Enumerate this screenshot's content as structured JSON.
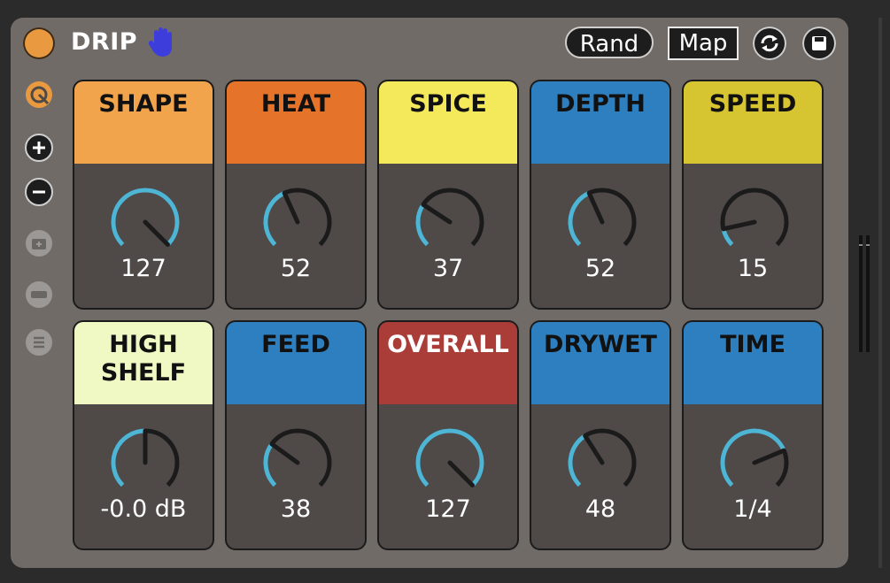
{
  "device": {
    "title": "DRIP",
    "rand_label": "Rand",
    "map_label": "Map",
    "accent": "#e99a40",
    "hand_color": "#3d3ddb"
  },
  "sidebar": {
    "items": [
      {
        "name": "hot-swap-icon"
      },
      {
        "name": "add-icon"
      },
      {
        "name": "remove-icon"
      },
      {
        "name": "camera-icon"
      },
      {
        "name": "collapse-icon"
      },
      {
        "name": "list-icon"
      }
    ]
  },
  "macros": [
    {
      "label": "SHAPE",
      "value": "127",
      "color": "#f1a44b",
      "level": 1.0
    },
    {
      "label": "HEAT",
      "value": "52",
      "color": "#e5742a",
      "level": 0.41
    },
    {
      "label": "SPICE",
      "value": "37",
      "color": "#f4e95a",
      "level": 0.29
    },
    {
      "label": "DEPTH",
      "value": "52",
      "color": "#2e7fbf",
      "level": 0.41
    },
    {
      "label": "SPEED",
      "value": "15",
      "color": "#d7c431",
      "level": 0.12
    },
    {
      "label": "HIGH SHELF",
      "value": "-0.0 dB",
      "color": "#f0f9c4",
      "level": 0.5
    },
    {
      "label": "FEED",
      "value": "38",
      "color": "#2e7fbf",
      "level": 0.3
    },
    {
      "label": "OVERALL",
      "value": "127",
      "color": "#aa3d38",
      "level": 1.0
    },
    {
      "label": "DRYWET",
      "value": "48",
      "color": "#2e7fbf",
      "level": 0.38
    },
    {
      "label": "TIME",
      "value": "1/4",
      "color": "#2e7fbf",
      "level": 0.75
    }
  ],
  "knob_colors": {
    "arc": "#4fb5d5",
    "track": "#1b1b1b",
    "needle": "#1b1b1b"
  }
}
